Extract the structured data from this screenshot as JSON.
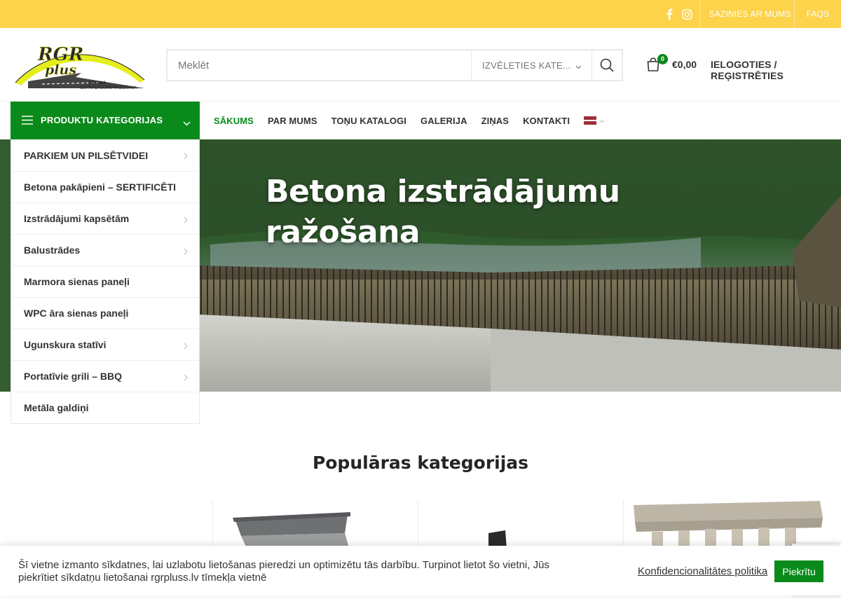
{
  "topbar": {
    "links": [
      "SAZINIES AR MUMS",
      "FAQS"
    ],
    "social": [
      "facebook-icon",
      "instagram-icon"
    ],
    "color": "#fcd34a"
  },
  "header": {
    "logo_alt": "RGR plus",
    "logo_text_big": "RGR",
    "logo_text_small": "plus",
    "logo_tag1": "BETONA",
    "logo_tag2": "IZSTRĀDĀJUMU RAŽOŠANA",
    "search_placeholder": "Meklēt",
    "category_select": "IZVĒLETIES KATE...",
    "cart_count": "0",
    "cart_amount": "€0,00",
    "login": "IELOGOTIES / REĢISTRĒTIES"
  },
  "nav": {
    "categories_button": "PRODUKTU KATEGORIJAS",
    "items": [
      "SĀKUMS",
      "PAR MUMS",
      "TOŅU KATALOGI",
      "GALERIJA",
      "ZIŅAS",
      "KONTAKTI"
    ],
    "active_color": "#0a8a1a"
  },
  "category_menu": [
    {
      "label": "PARKIEM UN PILSĒTVIDEI",
      "has_sub": true
    },
    {
      "label": "Betona pakāpieni – SERTIFICĒTI",
      "has_sub": false
    },
    {
      "label": "Izstrādājumi kapsētām",
      "has_sub": true
    },
    {
      "label": "Balustrādes",
      "has_sub": true
    },
    {
      "label": "Marmora sienas paneļi",
      "has_sub": false
    },
    {
      "label": "WPC āra sienas paneļi",
      "has_sub": false
    },
    {
      "label": "Ugunskura statīvi",
      "has_sub": true
    },
    {
      "label": "Portatīvie grili – BBQ",
      "has_sub": true
    },
    {
      "label": "Metāla galdiņi",
      "has_sub": false
    }
  ],
  "hero": {
    "title_line1": "Betona izstrādājumu",
    "title_line2": "ražošana"
  },
  "popular": {
    "heading": "Populāras kategorijas"
  },
  "cookie": {
    "text": "Šī vietne izmanto sīkdatnes, lai uzlabotu lietošanas pieredzi un optimizētu tās darbību. Turpinot lietot šo vietni, Jūs piekrītiet sīkdatņu lietošanai rgrpluss.lv tīmekļa vietnē",
    "policy_link": "Konfidencionalitātes politika",
    "accept": "Piekrītu"
  }
}
